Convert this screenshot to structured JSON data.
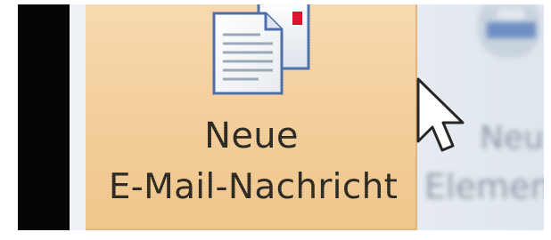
{
  "ribbon": {
    "new_mail_button": {
      "line1": "Neue",
      "line2": "E-Mail-Nachricht",
      "icon": "new-mail-icon"
    },
    "next_button": {
      "line1": "Neu",
      "line2": "Elemen",
      "icon": "new-items-icon"
    }
  },
  "cursor": {
    "icon": "mouse-pointer-icon"
  },
  "colors": {
    "button_highlight": "#f3cf9b",
    "ribbon_background": "#eef2f6",
    "text": "#2b2721"
  }
}
